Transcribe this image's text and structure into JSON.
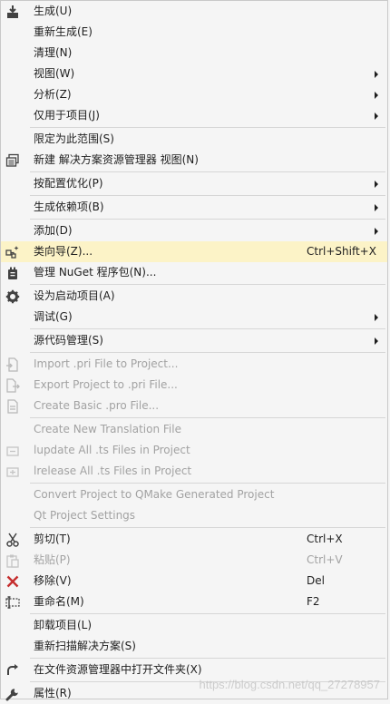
{
  "menu": {
    "items": [
      {
        "label": "生成(U)"
      },
      {
        "label": "重新生成(E)"
      },
      {
        "label": "清理(N)"
      },
      {
        "label": "视图(W)"
      },
      {
        "label": "分析(Z)"
      },
      {
        "label": "仅用于项目(J)"
      },
      {
        "label": "限定为此范围(S)"
      },
      {
        "label": "新建 解决方案资源管理器 视图(N)"
      },
      {
        "label": "按配置优化(P)"
      },
      {
        "label": "生成依赖项(B)"
      },
      {
        "label": "添加(D)"
      },
      {
        "label": "类向导(Z)...",
        "shortcut": "Ctrl+Shift+X"
      },
      {
        "label": "管理 NuGet 程序包(N)..."
      },
      {
        "label": "设为启动项目(A)"
      },
      {
        "label": "调试(G)"
      },
      {
        "label": "源代码管理(S)"
      },
      {
        "label": "Import .pri File to Project..."
      },
      {
        "label": "Export Project to .pri File..."
      },
      {
        "label": "Create Basic .pro File..."
      },
      {
        "label": "Create New Translation File"
      },
      {
        "label": "lupdate All .ts Files in Project"
      },
      {
        "label": "lrelease All .ts Files in Project"
      },
      {
        "label": "Convert Project to QMake Generated Project"
      },
      {
        "label": "Qt Project Settings"
      },
      {
        "label": "剪切(T)",
        "shortcut": "Ctrl+X"
      },
      {
        "label": "粘贴(P)",
        "shortcut": "Ctrl+V"
      },
      {
        "label": "移除(V)",
        "shortcut": "Del"
      },
      {
        "label": "重命名(M)",
        "shortcut": "F2"
      },
      {
        "label": "卸载项目(L)"
      },
      {
        "label": "重新扫描解决方案(S)"
      },
      {
        "label": "在文件资源管理器中打开文件夹(X)"
      },
      {
        "label": "属性(R)"
      }
    ]
  },
  "watermark": "https://blog.csdn.net/qq_27278957",
  "colors": {
    "hover": "#fcf3c7",
    "disabled": "#a2a2a2",
    "remove": "#c52d2d"
  }
}
